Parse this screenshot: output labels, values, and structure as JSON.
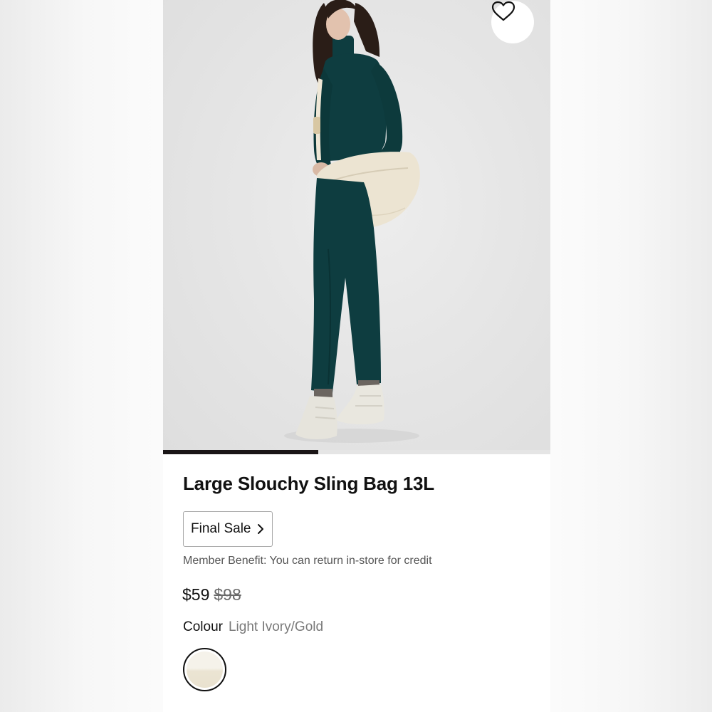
{
  "product": {
    "title": "Large Slouchy Sling Bag 13L",
    "final_sale_label": "Final Sale",
    "member_benefit": "Member Benefit: You can return in-store for credit",
    "price_sale": "$59",
    "price_original": "$98",
    "colour_label": "Colour",
    "colour_value": "Light Ivory/Gold"
  },
  "gallery": {
    "image_progress_fraction": 0.4
  },
  "icons": {
    "wishlist": "heart-outline-icon",
    "final_sale_chevron": "chevron-right-icon"
  },
  "colors": {
    "text_primary": "#111111",
    "text_secondary": "#555555",
    "strike_price": "#6a6a6a",
    "progress_bar": "#1a1516",
    "swatch": "#f2eee3",
    "outfit": "#0d3a3c"
  }
}
